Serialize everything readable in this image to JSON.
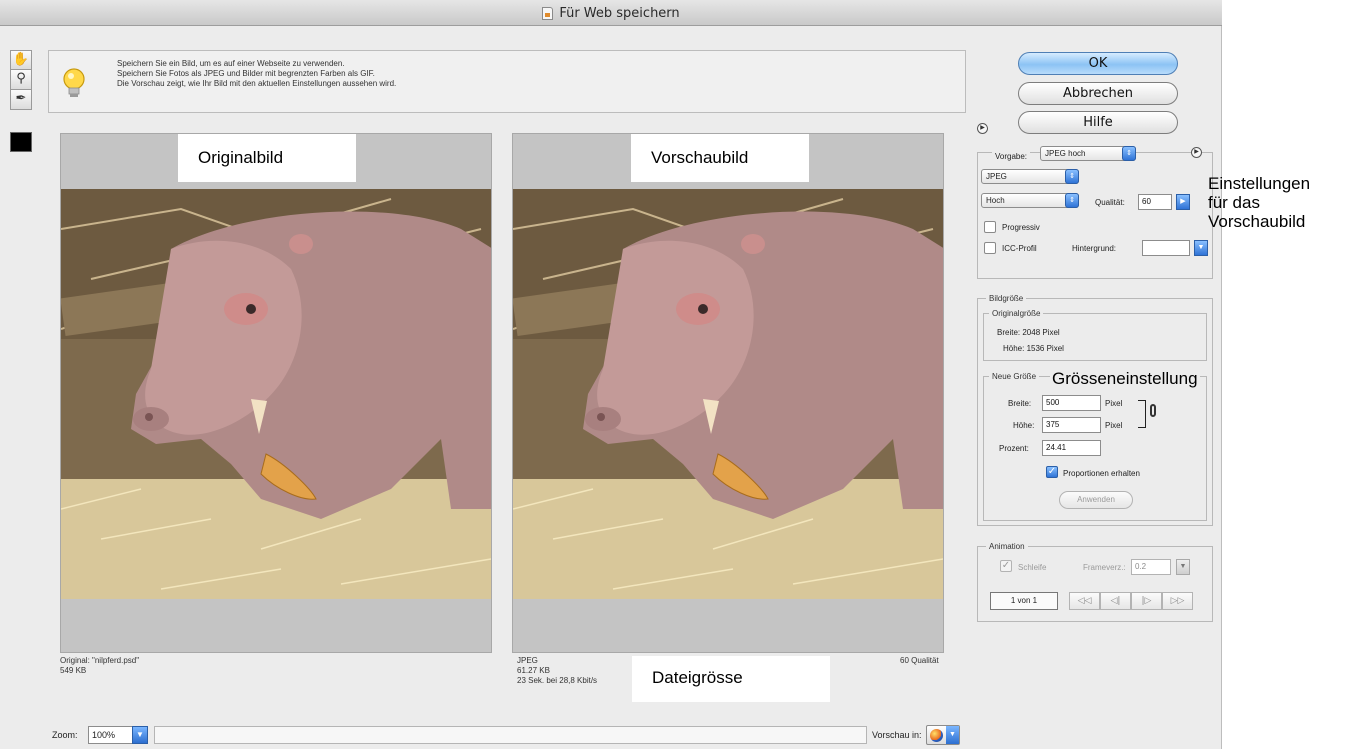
{
  "window": {
    "title": "Für Web speichern"
  },
  "tools": [
    {
      "name": "hand-tool",
      "glyph": "✋"
    },
    {
      "name": "zoom-tool",
      "glyph": "⚲"
    },
    {
      "name": "eyedropper-tool",
      "glyph": "✒"
    }
  ],
  "colors": {
    "swatch": "#000000",
    "default_button": "#8cc3f4",
    "popup_accent": "#2f73d6"
  },
  "tip": {
    "lines": [
      "Speichern Sie ein Bild, um es auf einer Webseite zu verwenden.",
      "Speichern Sie Fotos als JPEG und Bilder mit begrenzten Farben als GIF.",
      "Die Vorschau zeigt, wie Ihr Bild mit den aktuellen Einstellungen aussehen wird."
    ]
  },
  "panes": {
    "original_caption": "Originalbild",
    "preview_caption": "Vorschaubild"
  },
  "original_info": {
    "line1": "Original: \"nilpferd.psd\"",
    "line2": "549 KB"
  },
  "preview_info": {
    "format": "JPEG",
    "size": "61.27 KB",
    "time": "23 Sek. bei 28,8 Kbit/s",
    "quality": "60 Qualität",
    "callout": "Dateigrösse"
  },
  "zoom": {
    "label": "Zoom:",
    "value": "100%",
    "preview_label": "Vorschau in:"
  },
  "buttons": {
    "ok": "OK",
    "cancel": "Abbrechen",
    "help": "Hilfe"
  },
  "settings": {
    "preset_label": "Vorgabe:",
    "preset_value": "JPEG hoch",
    "format_value": "JPEG",
    "compression_value": "Hoch",
    "quality_label": "Qualität:",
    "quality_value": "60",
    "progressive_label": "Progressiv",
    "progressive_checked": false,
    "icc_label": "ICC-Profil",
    "icc_checked": false,
    "background_label": "Hintergrund:",
    "background_value": "",
    "callout_lines": [
      "Einstellungen",
      "für das",
      "Vorschaubild"
    ]
  },
  "image_size": {
    "group_label": "Bildgröße",
    "original_group_label": "Originalgröße",
    "original_width": "Breite:  2048 Pixel",
    "original_height": "Höhe:  1536 Pixel",
    "new_group_label": "Neue Größe",
    "callout": "Grösseneinstellung",
    "width_label": "Breite:",
    "width_value": "500",
    "height_label": "Höhe:",
    "height_value": "375",
    "unit": "Pixel",
    "percent_label": "Prozent:",
    "percent_value": "24.41",
    "constrain_label": "Proportionen erhalten",
    "constrain_checked": true,
    "apply_button": "Anwenden"
  },
  "animation": {
    "group_label": "Animation",
    "loop_label": "Schleife",
    "loop_checked": true,
    "delay_label": "Frameverz.:",
    "delay_value": "0.2",
    "frame_counter": "1 von 1",
    "nav": [
      "◁◁",
      "◁|",
      "|▷",
      "▷▷"
    ]
  }
}
